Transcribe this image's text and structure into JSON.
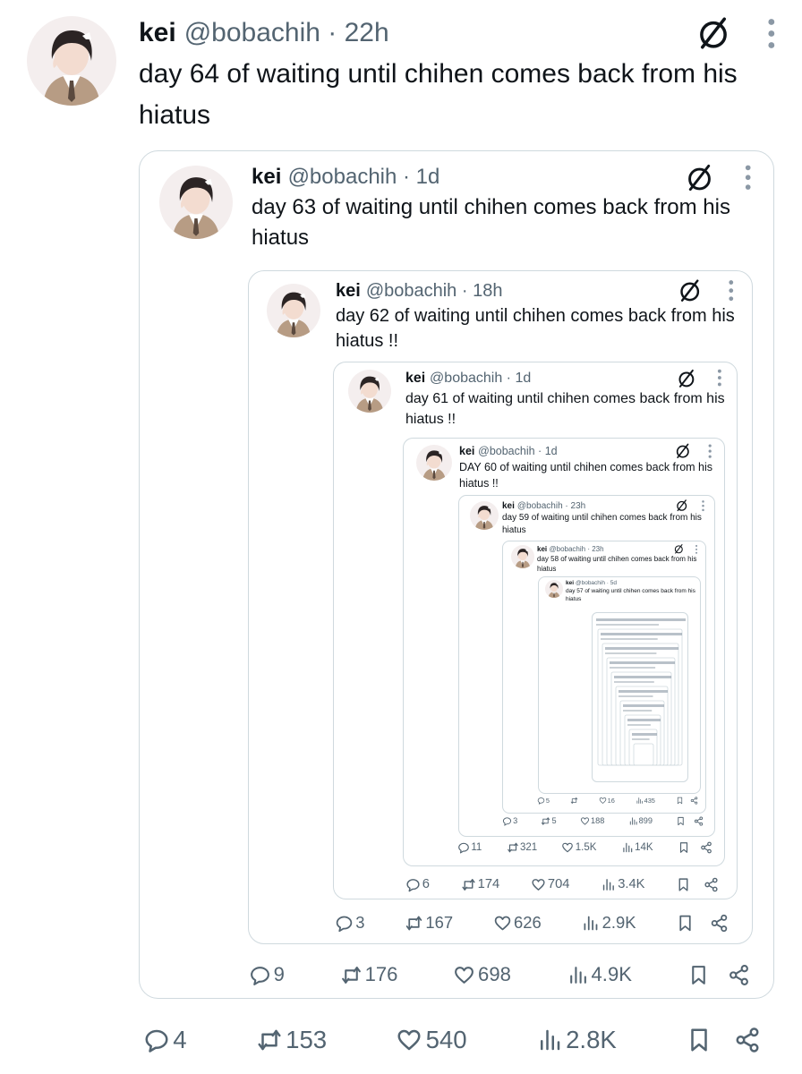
{
  "tweets": [
    {
      "name": "kei",
      "handle": "@bobachih",
      "time": "22h",
      "text": "day 64 of waiting until chihen comes back from his hiatus",
      "replies": "4",
      "reposts": "153",
      "likes": "540",
      "views": "2.8K"
    },
    {
      "name": "kei",
      "handle": "@bobachih",
      "time": "1d",
      "text": "day 63 of waiting until chihen comes back from his hiatus",
      "replies": "9",
      "reposts": "176",
      "likes": "698",
      "views": "4.9K"
    },
    {
      "name": "kei",
      "handle": "@bobachih",
      "time": "18h",
      "text": "day 62 of waiting until chihen comes back from his hiatus !!",
      "replies": "3",
      "reposts": "167",
      "likes": "626",
      "views": "2.9K"
    },
    {
      "name": "kei",
      "handle": "@bobachih",
      "time": "1d",
      "text": "day 61 of waiting until chihen comes back from his hiatus !!",
      "replies": "6",
      "reposts": "174",
      "likes": "704",
      "views": "3.4K"
    },
    {
      "name": "kei",
      "handle": "@bobachih",
      "time": "1d",
      "text": "DAY 60 of waiting until chihen comes back from his hiatus !!",
      "replies": "11",
      "reposts": "321",
      "likes": "1.5K",
      "views": "14K"
    },
    {
      "name": "kei",
      "handle": "@bobachih",
      "time": "23h",
      "text": "day 59 of waiting until chihen comes back from his hiatus",
      "replies": "3",
      "reposts": "5",
      "likes": "188",
      "views": "899"
    },
    {
      "name": "kei",
      "handle": "@bobachih",
      "time": "23h",
      "text": "day 58 of waiting until chihen comes back from his hiatus",
      "replies": "5",
      "reposts": "",
      "likes": "16",
      "views": "435"
    },
    {
      "name": "kei",
      "handle": "@bobachih",
      "time": "5d",
      "text": "day 57 of waiting until chihen comes back from his hiatus",
      "replies": "",
      "reposts": "",
      "likes": "",
      "views": ""
    }
  ],
  "icons": {
    "reply": "speech-bubble-icon",
    "repost": "repost-arrows-icon",
    "like": "heart-icon",
    "views": "bar-chart-icon",
    "bookmark": "bookmark-icon",
    "share": "share-nodes-icon",
    "header": "slashed-circle-icon",
    "more": "more-dots-icon"
  },
  "colors": {
    "text": "#0f1419",
    "secondary": "#536471",
    "border": "#cfd9de",
    "background": "#ffffff"
  }
}
